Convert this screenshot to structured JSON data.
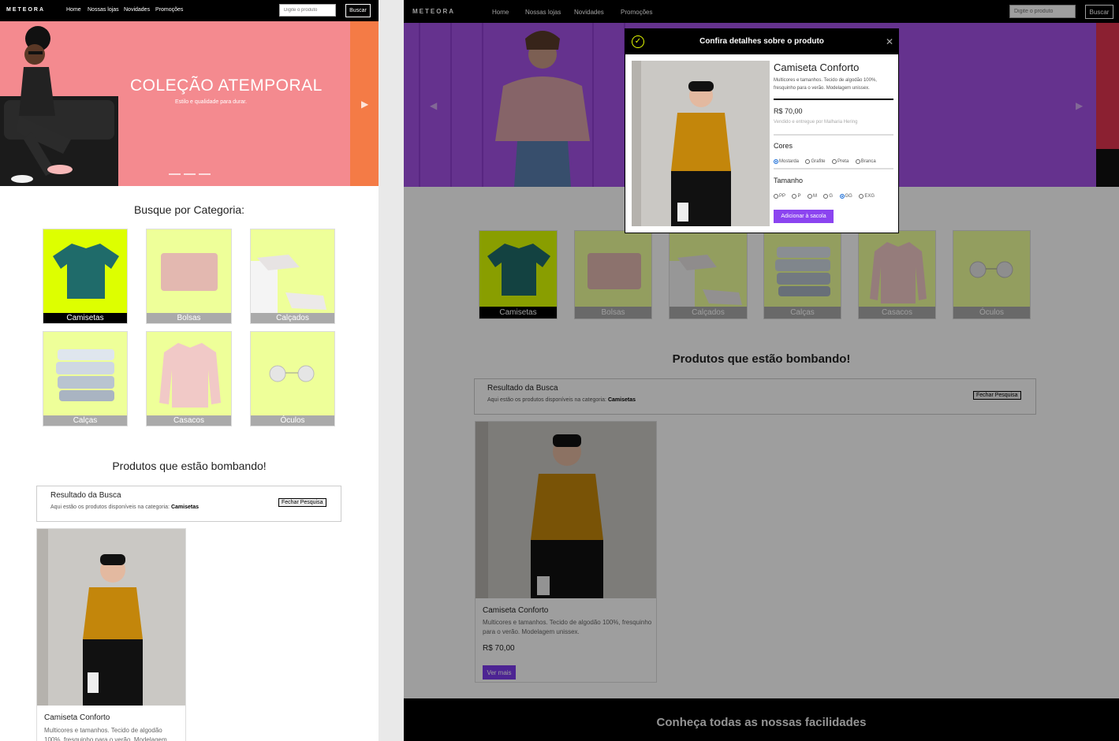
{
  "brand": {
    "logo": "METEORA"
  },
  "nav": {
    "links": [
      "Home",
      "Nossas lojas",
      "Novidades",
      "Promoções"
    ]
  },
  "search": {
    "placeholder": "Digite o produto",
    "button": "Buscar"
  },
  "hero": {
    "title": "COLEÇÃO ATEMPORAL",
    "subtitle": "Estilo e qualidade para durar."
  },
  "categories": {
    "title": "Busque por Categoria:",
    "items": [
      "Camisetas",
      "Bolsas",
      "Calçados",
      "Calças",
      "Casacos",
      "Óculos"
    ],
    "selected": "Camisetas"
  },
  "products": {
    "title": "Produtos que estão bombando!",
    "result_title": "Resultado da Busca",
    "result_desc": "Aqui estão os produtos disponíveis na categoria:",
    "result_category": "Camisetas",
    "close_search": "Fechar Pesquisa",
    "card": {
      "name": "Camiseta Conforto",
      "desc": "Multicores e tamanhos. Tecido de algodão 100%, fresquinho para o verão. Modelagem unissex.",
      "desc_left": "Multicores e tamanhos. Tecido de algodão 100%, fresquinho para o verão. Modelagem",
      "price": "R$ 70,00",
      "button": "Ver mais"
    }
  },
  "modal": {
    "title": "Confira detalhes sobre o produto",
    "product_name": "Camiseta Conforto",
    "desc": "Multicores e tamanhos. Tecido de algodão 100%, fresquinho para o verão. Modelagem unissex.",
    "price": "R$ 70,00",
    "seller": "Vendido e entregue por Malharia Hering",
    "colors_label": "Cores",
    "colors": [
      "Mostarda",
      "Grafite",
      "Preta",
      "Branca"
    ],
    "selected_color": "Mostarda",
    "size_label": "Tamanho",
    "sizes": [
      "PP",
      "P",
      "M",
      "G",
      "GG",
      "EXG"
    ],
    "selected_size": "GG",
    "add_button": "Adicionar à sacola"
  },
  "footer": {
    "title": "Conheça todas as nossas facilidades"
  },
  "colors": {
    "accent": "#7c3aed",
    "brand_yellow": "#e8ff00",
    "category_bg": "#eeff99"
  }
}
